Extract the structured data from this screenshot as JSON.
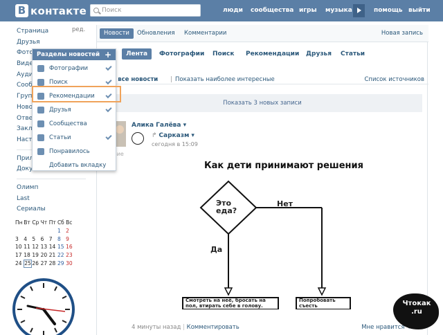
{
  "header": {
    "logo_letter": "В",
    "logo_text": "контакте",
    "search_placeholder": "Поиск",
    "nav": [
      "люди",
      "сообщества",
      "игры",
      "музыка",
      "помощь",
      "выйти"
    ]
  },
  "sidebar": {
    "edit_label": "ред.",
    "items": [
      "Страница",
      "Друзья",
      "Фотографии",
      "Видеозаписи",
      "Аудиозаписи",
      "Сообщения",
      "Группы",
      "Новости",
      "Ответы",
      "Закладки",
      "Настройки"
    ],
    "items_2": [
      "Приложения",
      "Документы"
    ],
    "items_3": [
      "Олимп",
      "Last",
      "Сериалы"
    ]
  },
  "calendar": {
    "headers": [
      "Пн",
      "Вт",
      "Ср",
      "Чт",
      "Пт",
      "Сб",
      "Вс"
    ],
    "rows": [
      [
        "",
        "",
        "",
        "",
        "",
        "1",
        "2"
      ],
      [
        "3",
        "4",
        "5",
        "6",
        "7",
        "8",
        "9"
      ],
      [
        "10",
        "11",
        "12",
        "13",
        "14",
        "15",
        "16"
      ],
      [
        "17",
        "18",
        "19",
        "20",
        "21",
        "22",
        "23"
      ],
      [
        "24",
        "25",
        "26",
        "27",
        "28",
        "29",
        "30"
      ]
    ],
    "today": "25"
  },
  "main": {
    "tabs": [
      "Новости",
      "Обновления",
      "Комментарии"
    ],
    "new_post": "Новая запись",
    "subtabs": [
      "Лента",
      "Фотографии",
      "Поиск",
      "Рекомендации",
      "Друзья",
      "Статьи"
    ],
    "filter_left": "аны все новости",
    "filter_sep": "|",
    "filter_alt": "Показать наиболее интересные",
    "sources": "Список источников",
    "show_new": "Показать 3 новых записи"
  },
  "post": {
    "author": "Алика Галёва",
    "repost_name": "Сарказм",
    "repost_time": "сегодня в 15:09",
    "side_label": "вие",
    "meme_title": "Как дети принимают решения",
    "meme_question": "Это еда?",
    "meme_no": "Нет",
    "meme_yes": "Да",
    "meme_box_left": "Смотреть на неё, бросать на пол, втирать себе в голову.",
    "meme_box_right": "Попробовать съесть",
    "footer_time": "4 минуты назад",
    "footer_comment": "Комментировать",
    "likes_label": "Мне нравится",
    "likes_count": "1"
  },
  "dropdown": {
    "title": "Разделы новостей",
    "items": [
      {
        "label": "Фотографии",
        "checked": true
      },
      {
        "label": "Поиск",
        "checked": true
      },
      {
        "label": "Рекомендации",
        "checked": true
      },
      {
        "label": "Друзья",
        "checked": true
      },
      {
        "label": "Сообщества",
        "checked": false
      },
      {
        "label": "Статьи",
        "checked": true
      },
      {
        "label": "Понравилось",
        "checked": false
      }
    ],
    "add_tab": "Добавить вкладку"
  },
  "watermark": {
    "text": "Чтокак .ru"
  },
  "colors": {
    "brand": "#5b7fa6",
    "highlight": "#f0a35a",
    "link": "#2b587a"
  }
}
